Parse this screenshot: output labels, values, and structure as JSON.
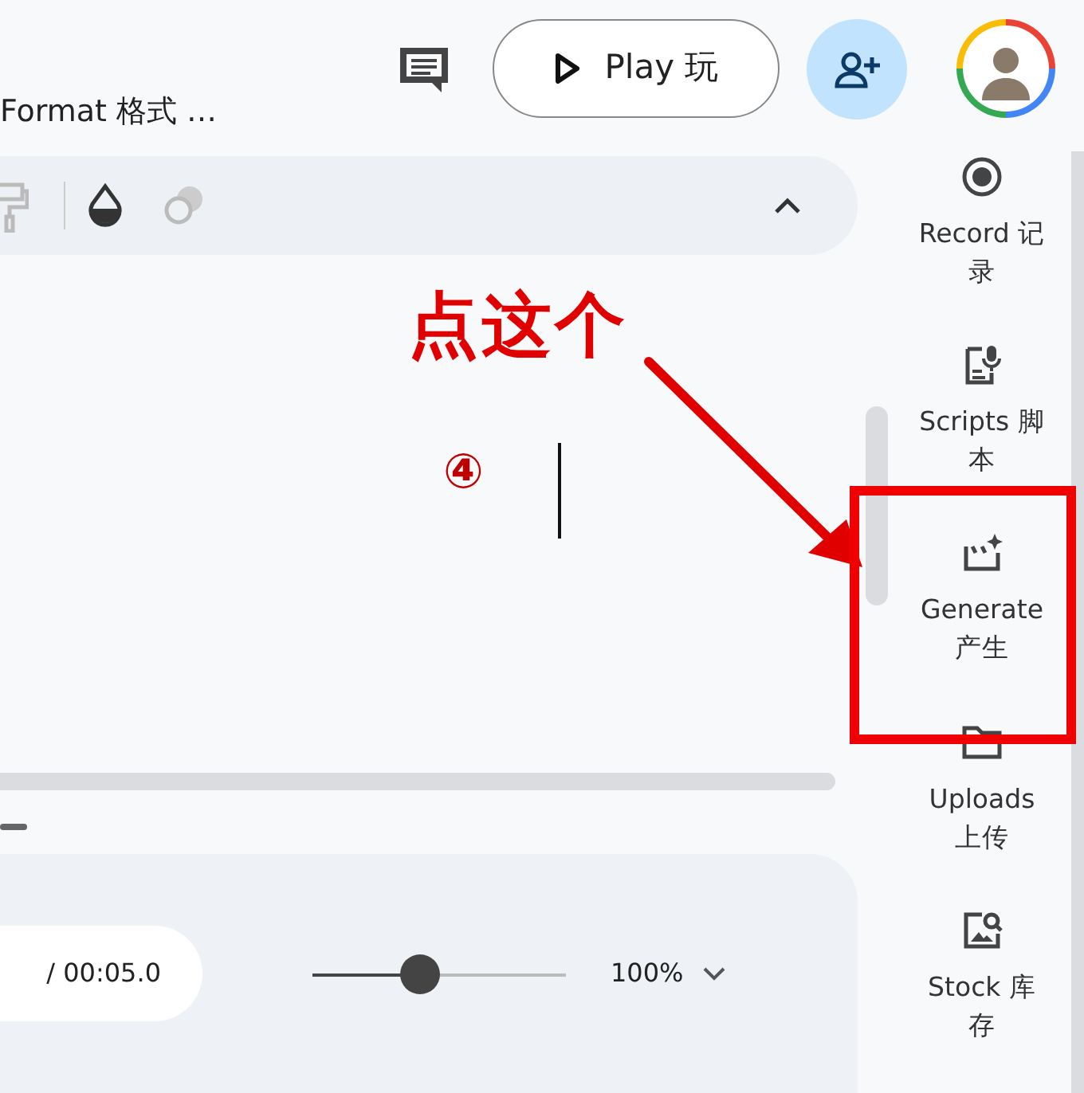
{
  "menu": {
    "label": "Format 格式",
    "more": "…"
  },
  "play_button": {
    "label": "Play 玩"
  },
  "playback": {
    "time": "/ 00:05.0",
    "zoom_slider": {
      "level": 0.42
    },
    "zoom_reading": "100%"
  },
  "sidebar": {
    "items": [
      {
        "kind": "record",
        "lines": [
          "Record 记",
          "录"
        ]
      },
      {
        "kind": "scripts",
        "lines": [
          "Scripts 脚",
          "本"
        ]
      },
      {
        "kind": "generate",
        "lines": [
          "Generate",
          "产生"
        ]
      },
      {
        "kind": "uploads",
        "lines": [
          "Uploads",
          "上传"
        ]
      },
      {
        "kind": "stock",
        "lines": [
          "Stock 库",
          "存"
        ]
      }
    ]
  },
  "annotation": {
    "callout": "点这个",
    "step": "④"
  }
}
